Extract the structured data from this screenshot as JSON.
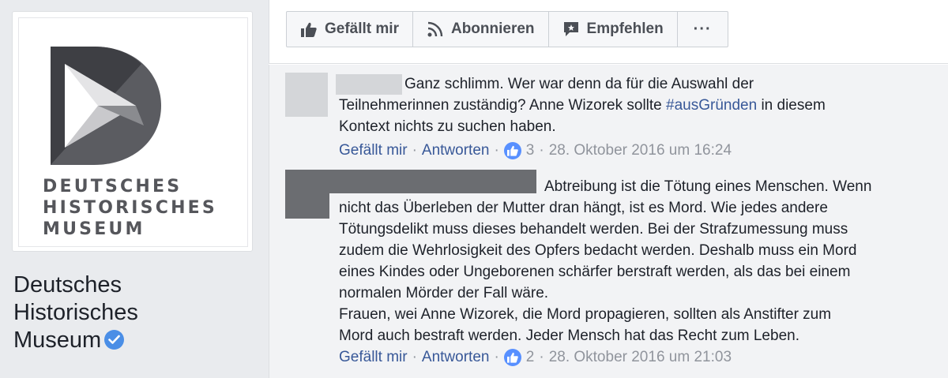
{
  "profile": {
    "logo_lines": [
      "DEUTSCHES",
      "HISTORISCHES",
      "MUSEUM"
    ],
    "name_lines": [
      "Deutsches",
      "Historisches",
      "Museum"
    ],
    "verified_icon": "verified-badge-icon"
  },
  "action_bar": {
    "like": "Gefällt mir",
    "follow": "Abonnieren",
    "recommend": "Empfehlen",
    "more": "···"
  },
  "comments": [
    {
      "lines": [
        "Ganz schlimm. Wer war denn da für die Auswahl der",
        "Teilnehmerinnen zuständig? Anne Wizorek sollte ",
        "Kontext nichts zu suchen haben."
      ],
      "hashtag": "#ausGründen",
      "after_hashtag": " in diesem",
      "like_label": "Gefällt mir",
      "reply_label": "Antworten",
      "like_count": "3",
      "timestamp": "28. Oktober 2016 um 16:24"
    },
    {
      "lines": [
        "Abtreibung ist die Tötung eines Menschen. Wenn",
        "nicht das Überleben der Mutter dran hängt, ist es Mord. Wie jedes andere",
        "Tötungsdelikt muss dieses behandelt werden. Bei der Strafzumessung muss",
        "zudem die Wehrlosigkeit des Opfers bedacht werden. Deshalb muss ein Mord",
        "eines Kindes oder Ungeborenen schärfer berstraft werden, als das bei einem",
        "normalen Mörder der Fall wäre.",
        "Frauen, wei Anne Wizorek, die Mord propagieren, sollten als Anstifter zum",
        "Mord auch bestraft werden. Jeder Mensch hat das Recht zum Leben."
      ],
      "like_label": "Gefällt mir",
      "reply_label": "Antworten",
      "like_count": "2",
      "timestamp": "28. Oktober 2016 um 21:03"
    }
  ],
  "colors": {
    "link": "#385898",
    "meta": "#90949c",
    "like_blue": "#5890ff",
    "verified_blue": "#4a8ee6"
  }
}
